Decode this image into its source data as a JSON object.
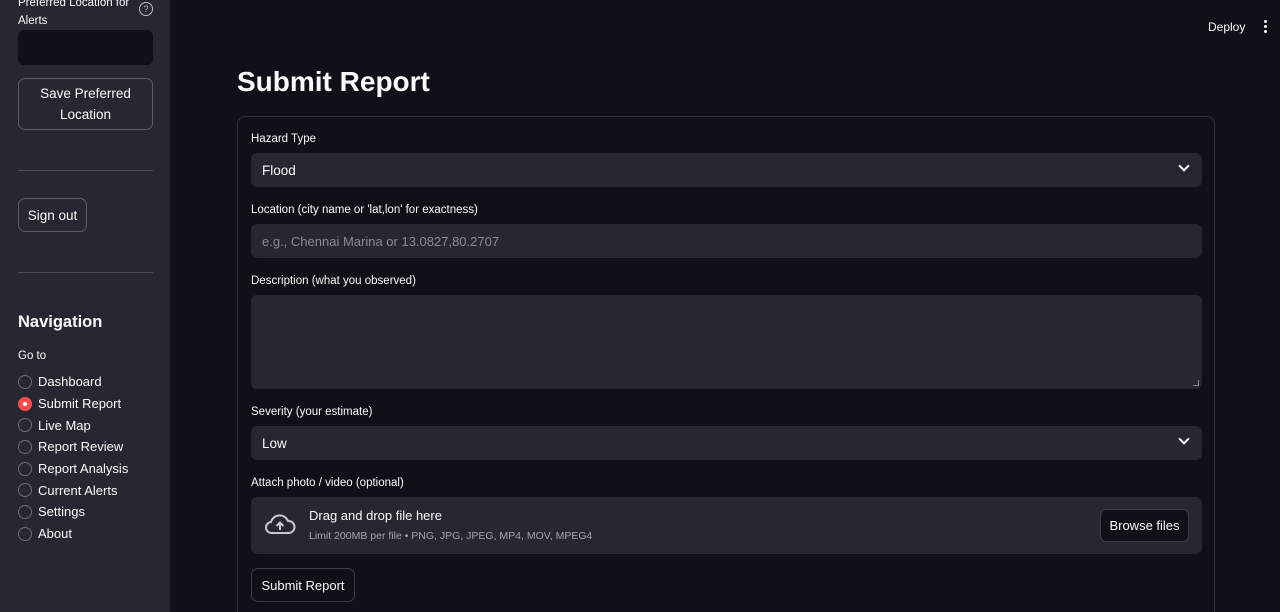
{
  "sidebar": {
    "preferred_location_label": "Preferred Location for Alerts",
    "preferred_location_value": "",
    "save_button": "Save Preferred Location",
    "sign_out_button": "Sign out",
    "nav_title": "Navigation",
    "goto_label": "Go to",
    "nav_items": [
      {
        "label": "Dashboard",
        "selected": false
      },
      {
        "label": "Submit Report",
        "selected": true
      },
      {
        "label": "Live Map",
        "selected": false
      },
      {
        "label": "Report Review",
        "selected": false
      },
      {
        "label": "Report Analysis",
        "selected": false
      },
      {
        "label": "Current Alerts",
        "selected": false
      },
      {
        "label": "Settings",
        "selected": false
      },
      {
        "label": "About",
        "selected": false
      }
    ]
  },
  "header": {
    "deploy_label": "Deploy"
  },
  "main": {
    "title": "Submit Report",
    "form": {
      "hazard_type_label": "Hazard Type",
      "hazard_type_value": "Flood",
      "location_label": "Location (city name or 'lat,lon' for exactness)",
      "location_placeholder": "e.g., Chennai Marina or 13.0827,80.2707",
      "description_label": "Description (what you observed)",
      "description_value": "",
      "severity_label": "Severity (your estimate)",
      "severity_value": "Low",
      "attach_label": "Attach photo / video (optional)",
      "drop_title": "Drag and drop file here",
      "drop_subtitle": "Limit 200MB per file • PNG, JPG, JPEG, MP4, MOV, MPEG4",
      "browse_button": "Browse files",
      "submit_button": "Submit Report"
    }
  },
  "colors": {
    "background": "#0e1117",
    "sidebar": "#262730",
    "accent": "#ff4b4b"
  },
  "icons": {
    "help": "help-circle-icon",
    "menu": "kebab-menu-icon",
    "upload": "cloud-upload-icon",
    "dropdown": "chevron-down-icon"
  }
}
